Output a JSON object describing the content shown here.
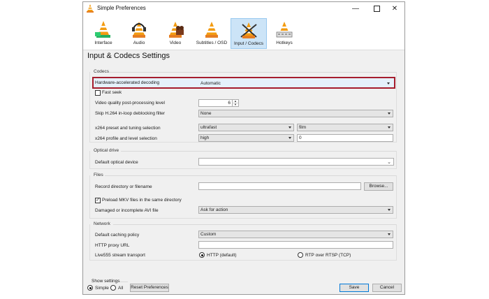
{
  "window": {
    "title": "Simple Preferences"
  },
  "toolbar": {
    "items": [
      {
        "label": "Interface"
      },
      {
        "label": "Audio"
      },
      {
        "label": "Video"
      },
      {
        "label": "Subtitles / OSD"
      },
      {
        "label": "Input / Codecs"
      },
      {
        "label": "Hotkeys"
      }
    ]
  },
  "page": {
    "heading": "Input & Codecs Settings"
  },
  "codecs": {
    "group_title": "Codecs",
    "hw_decoding": {
      "label": "Hardware-accelerated decoding",
      "value": "Automatic"
    },
    "fast_seek": {
      "label": "Fast seek",
      "checked": false
    },
    "video_quality": {
      "label": "Video quality post-processing level",
      "value": "6"
    },
    "skip_h264": {
      "label": "Skip H.264 in-loop deblocking filter",
      "value": "None"
    },
    "x264_preset": {
      "label": "x264 preset and tuning selection",
      "preset": "ultrafast",
      "tune": "film"
    },
    "x264_profile": {
      "label": "x264 profile and level selection",
      "profile": "high",
      "level": "0"
    }
  },
  "optical": {
    "group_title": "Optical drive",
    "device": {
      "label": "Default optical device",
      "value": ""
    }
  },
  "files": {
    "group_title": "Files",
    "record": {
      "label": "Record directory or filename",
      "value": "",
      "browse": "Browse..."
    },
    "preload_mkv": {
      "label": "Preload MKV files in the same directory",
      "checked": true
    },
    "damaged_avi": {
      "label": "Damaged or incomplete AVI file",
      "value": "Ask for action"
    }
  },
  "network": {
    "group_title": "Network",
    "caching": {
      "label": "Default caching policy",
      "value": "Custom"
    },
    "proxy": {
      "label": "HTTP proxy URL",
      "value": ""
    },
    "live555": {
      "label": "Live555 stream transport",
      "option_http": "HTTP (default)",
      "option_rtp": "RTP over RTSP (TCP)",
      "selected": "http"
    }
  },
  "footer": {
    "show_settings": "Show settings",
    "simple": "Simple",
    "all": "All",
    "reset": "Reset Preferences",
    "save": "Save",
    "cancel": "Cancel"
  },
  "colors": {
    "highlight_border": "#a51d2d",
    "selected_tab": "#cce4f7",
    "cone_orange": "#f39c12"
  }
}
